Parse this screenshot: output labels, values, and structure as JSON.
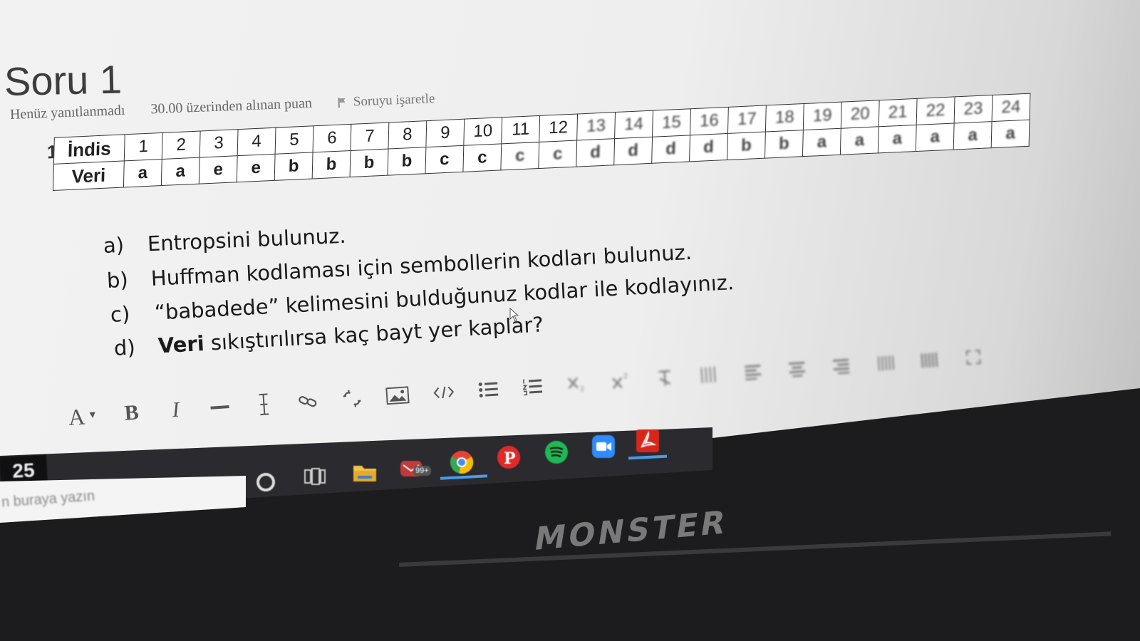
{
  "question": {
    "title": "Soru 1",
    "status": "Henüz yanıtlanmadı",
    "points": "30.00 üzerinden alınan puan",
    "flag_label": "Soruyu işaretle",
    "number": "1."
  },
  "table": {
    "header_label": "İndis",
    "data_label": "Veri",
    "indices": [
      "1",
      "2",
      "3",
      "4",
      "5",
      "6",
      "7",
      "8",
      "9",
      "10",
      "11",
      "12",
      "13",
      "14",
      "15",
      "16",
      "17",
      "18",
      "19",
      "20",
      "21",
      "22",
      "23",
      "24"
    ],
    "values": [
      "a",
      "a",
      "e",
      "e",
      "b",
      "b",
      "b",
      "b",
      "c",
      "c",
      "c",
      "c",
      "d",
      "d",
      "d",
      "d",
      "b",
      "b",
      "a",
      "a",
      "a",
      "a",
      "a",
      "a"
    ]
  },
  "parts": {
    "a": {
      "label": "a)",
      "text": "Entropsini bulunuz."
    },
    "b": {
      "label": "b)",
      "text": "Huffman kodlaması için sembollerin kodları bulunuz."
    },
    "c": {
      "label": "c)",
      "text": "“babadede” kelimesini bulduğunuz kodlar ile kodlayınız."
    },
    "d": {
      "label": "d)",
      "bold": "Veri",
      "text": "sıkıştırılırsa kaç bayt yer kaplar?"
    }
  },
  "toolbar": {
    "font_label": "A",
    "bold_label": "B",
    "italic_label": "I"
  },
  "taskbar": {
    "clock": "25",
    "search_placeholder": "n buraya yazın",
    "mail_badge": "99+"
  },
  "brand": "MONSTER",
  "colors": {
    "chrome": "#4a8af4",
    "pinterest": "#e02a2a",
    "spotify": "#1db954",
    "zoom": "#2d8cff",
    "acrobat": "#d9261c"
  }
}
